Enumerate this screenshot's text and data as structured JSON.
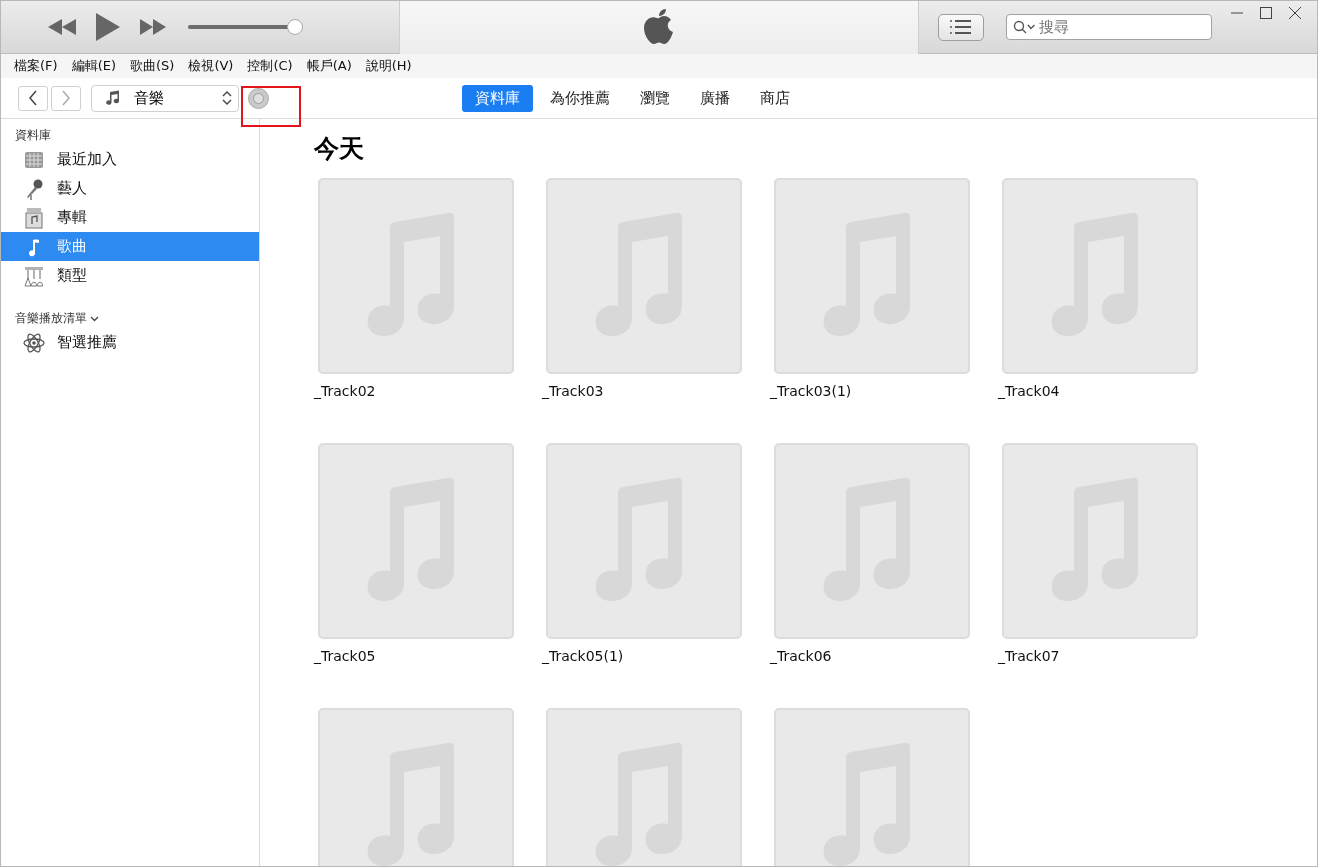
{
  "player": {
    "volume": {
      "level": 0.93
    }
  },
  "search": {
    "placeholder": "搜尋"
  },
  "menu": [
    "檔案(F)",
    "編輯(E)",
    "歌曲(S)",
    "檢視(V)",
    "控制(C)",
    "帳戶(A)",
    "說明(H)"
  ],
  "media_picker": {
    "label": "音樂"
  },
  "tabs": [
    {
      "label": "資料庫",
      "selected": true
    },
    {
      "label": "為你推薦",
      "selected": false
    },
    {
      "label": "瀏覽",
      "selected": false
    },
    {
      "label": "廣播",
      "selected": false
    },
    {
      "label": "商店",
      "selected": false
    }
  ],
  "sidebar": {
    "library_heading": "資料庫",
    "library_items": [
      {
        "label": "最近加入",
        "kind": "recent",
        "selected": false
      },
      {
        "label": "藝人",
        "kind": "artists",
        "selected": false
      },
      {
        "label": "專輯",
        "kind": "albums",
        "selected": false
      },
      {
        "label": "歌曲",
        "kind": "songs",
        "selected": true
      },
      {
        "label": "類型",
        "kind": "genres",
        "selected": false
      }
    ],
    "playlists_heading": "音樂播放清單",
    "playlists_expanded": true,
    "playlist_items": [
      {
        "label": "智選推薦",
        "kind": "genius",
        "selected": false
      }
    ]
  },
  "content": {
    "heading": "今天",
    "albums": [
      {
        "title": "_Track02",
        "kind": "placeholder"
      },
      {
        "title": "_Track03",
        "kind": "placeholder"
      },
      {
        "title": "_Track03(1)",
        "kind": "placeholder"
      },
      {
        "title": "_Track04",
        "kind": "placeholder"
      },
      {
        "title": "_Track05",
        "kind": "placeholder"
      },
      {
        "title": "_Track05(1)",
        "kind": "placeholder"
      },
      {
        "title": "_Track06",
        "kind": "placeholder"
      },
      {
        "title": "_Track07",
        "kind": "placeholder"
      },
      {
        "kind": "placeholder"
      },
      {
        "kind": "placeholder"
      },
      {
        "kind": "placeholder"
      }
    ]
  }
}
